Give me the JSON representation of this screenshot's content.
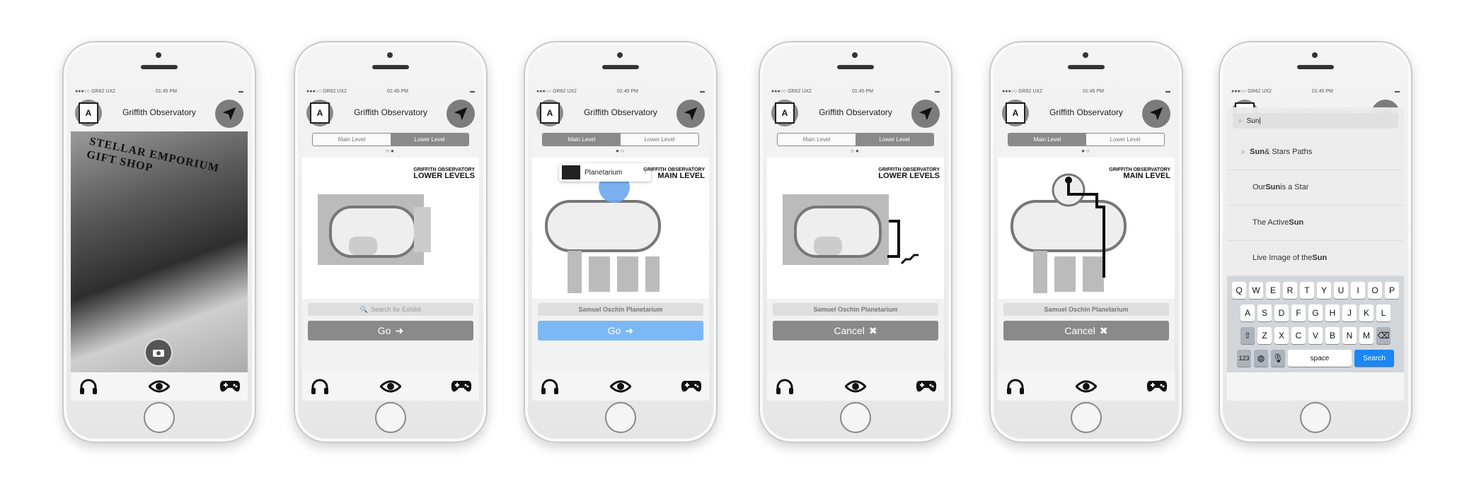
{
  "app": {
    "title": "Griffith Observatory",
    "status": {
      "carrier": "●●●○○ GR62 UX2",
      "time": "01:45 PM"
    }
  },
  "screens": [
    {
      "id": "camera",
      "photo_sign": "STELLAR EMPORIUM GIFT SHOP"
    },
    {
      "id": "lower",
      "segments": [
        "Main Level",
        "Lower Level"
      ],
      "active": 1,
      "map_title_small": "GRIFFITH OBSERVATORY",
      "map_title": "LOWER LEVELS",
      "field": "Search for Exhibit",
      "button": "Go"
    },
    {
      "id": "main",
      "segments": [
        "Main Level",
        "Lower Level"
      ],
      "active": 0,
      "map_title_small": "GRIFFITH OBSERVATORY",
      "map_title": "MAIN LEVEL",
      "popup": "Planetarium",
      "field": "Samuel Oschin Planetarium",
      "button": "Go"
    },
    {
      "id": "lower-route",
      "segments": [
        "Main Level",
        "Lower Level"
      ],
      "active": 1,
      "map_title_small": "GRIFFITH OBSERVATORY",
      "map_title": "LOWER LEVELS",
      "field": "Samuel Oschin Planetarium",
      "button": "Cancel"
    },
    {
      "id": "main-route",
      "segments": [
        "Main Level",
        "Lower Level"
      ],
      "active": 0,
      "map_title_small": "GRIFFITH OBSERVATORY",
      "map_title": "MAIN LEVEL",
      "field": "Samuel Oschin Planetarium",
      "button": "Cancel"
    },
    {
      "id": "search",
      "query": "Sun",
      "results": [
        {
          "pre": "",
          "bold": "Sun",
          "post": " & Stars Paths"
        },
        {
          "pre": "Our ",
          "bold": "Sun",
          "post": " is a Star"
        },
        {
          "pre": "The Active ",
          "bold": "Sun",
          "post": ""
        },
        {
          "pre": "Live Image of the ",
          "bold": "Sun",
          "post": ""
        }
      ],
      "keyboard": {
        "row1": [
          "Q",
          "W",
          "E",
          "R",
          "T",
          "Y",
          "U",
          "I",
          "O",
          "P"
        ],
        "row2": [
          "A",
          "S",
          "D",
          "F",
          "G",
          "H",
          "J",
          "K",
          "L"
        ],
        "row3": [
          "Z",
          "X",
          "C",
          "V",
          "B",
          "N",
          "M"
        ],
        "num": "123",
        "space": "space",
        "search": "Search"
      }
    }
  ],
  "icons": {
    "logo": "accessibility-logo-icon",
    "nav": "navigation-arrow-icon",
    "tabs": [
      "headphones-icon",
      "eye-icon",
      "gamepad-icon"
    ],
    "camera": "camera-icon",
    "go_arrow": "arrow-right-icon",
    "cancel": "close-icon"
  },
  "colors": {
    "blue_button": "#7cb8f5",
    "keyboard_search": "#1b86f5",
    "gray_button": "#8a8a8a"
  }
}
